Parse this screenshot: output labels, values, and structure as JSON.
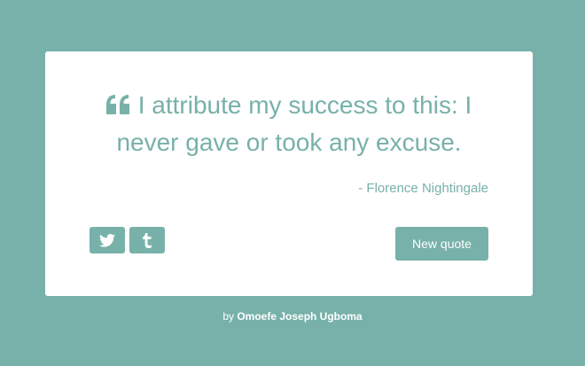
{
  "colors": {
    "background": "#77b1a9",
    "card": "#ffffff",
    "accent": "#77b1a9"
  },
  "quote": {
    "icon": "quote-left-icon",
    "text": "I attribute my success to this: I never gave or took any excuse.",
    "author": "- Florence Nightingale"
  },
  "share": {
    "twitter_icon": "twitter-icon",
    "tumblr_icon": "tumblr-icon"
  },
  "actions": {
    "new_quote_label": "New quote"
  },
  "footer": {
    "prefix": "by ",
    "author": "Omoefe Joseph Ugboma"
  }
}
